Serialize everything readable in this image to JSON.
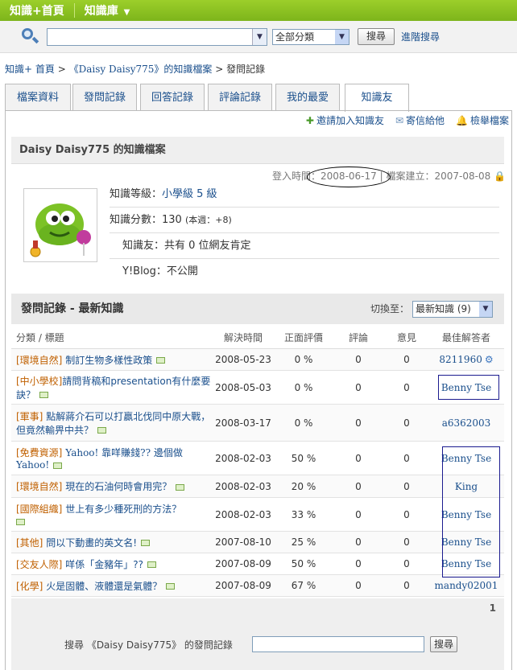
{
  "topbar": {
    "home": "知識+首頁",
    "library": "知識庫",
    "library_caret": "▼"
  },
  "search": {
    "placeholder": "",
    "dropdown": "▼",
    "category": "全部分類",
    "button": "搜尋",
    "advanced": "進階搜尋"
  },
  "breadcrumb": {
    "home": "知識+ 首頁",
    "sep1": ">",
    "profile": "《Daisy Daisy775》的知識檔案",
    "sep2": ">",
    "current": "發問記錄"
  },
  "tabs": [
    "檔案資料",
    "發問記錄",
    "回答記錄",
    "評論記錄",
    "我的最愛",
    "知識友"
  ],
  "actions": {
    "invite": "邀請加入知識友",
    "mail": "寄信給他",
    "report": "檢舉檔案"
  },
  "profile": {
    "heading": "Daisy Daisy775 的知識檔案",
    "login_label": "登入時間：",
    "login_date": "2008-06-17",
    "created_label": "| 檔案建立：",
    "created_date": "2007-08-08",
    "level_label": "知識等級：",
    "level_value": "小學級 5 級",
    "score_label": "知識分數：",
    "score_value": "130",
    "score_week": "(本週：+8)",
    "friends_label": "知識友：",
    "friends_value": "共有 0 位網友肯定",
    "blog_label": "Y!Blog：",
    "blog_value": "不公開"
  },
  "questions": {
    "title": "發問記錄 - 最新知識",
    "switch_label": "切換至：",
    "switch_value": "最新知識 (9)",
    "columns": [
      "分類 / 標題",
      "解決時間",
      "正面評價",
      "評論",
      "意見",
      "最佳解答者"
    ],
    "rows": [
      {
        "category": "[環境自然]",
        "title": "制訂生物多樣性政策",
        "date": "2008-05-23",
        "positive": "0 %",
        "comments": "0",
        "opinions": "0",
        "best": "8211960",
        "gear": "⚙"
      },
      {
        "category": "[中小學校]",
        "title": "請問背稿和presentation有什麼要訣？",
        "date": "2008-05-03",
        "positive": "0 %",
        "comments": "0",
        "opinions": "0",
        "best": "Benny Tse"
      },
      {
        "category": "[軍事]",
        "title": "點解蔣介石可以打贏北伐同中原大戰，但竟然輸畀中共？",
        "date": "2008-03-17",
        "positive": "0 %",
        "comments": "0",
        "opinions": "0",
        "best": "a6362003"
      },
      {
        "category": "[免費資源]",
        "title": "Yahoo! 靠咩賺錢?? 邊個做Yahoo!",
        "date": "2008-02-03",
        "positive": "50 %",
        "comments": "0",
        "opinions": "0",
        "best": "Benny Tse"
      },
      {
        "category": "[環境自然]",
        "title": "現在的石油何時會用完？",
        "date": "2008-02-03",
        "positive": "20 %",
        "comments": "0",
        "opinions": "0",
        "best": "King"
      },
      {
        "category": "[國際組織]",
        "title": "世上有多少種死刑的方法？",
        "date": "2008-02-03",
        "positive": "33 %",
        "comments": "0",
        "opinions": "0",
        "best": "Benny Tse"
      },
      {
        "category": "[其他]",
        "title": "問以下動畫的英文名!",
        "date": "2007-08-10",
        "positive": "25 %",
        "comments": "0",
        "opinions": "0",
        "best": "Benny Tse"
      },
      {
        "category": "[交友人際]",
        "title": "咩係「金豬年」??",
        "date": "2007-08-09",
        "positive": "50 %",
        "comments": "0",
        "opinions": "0",
        "best": "Benny Tse"
      },
      {
        "category": "[化學]",
        "title": "火是固體、液體還是氣體？",
        "date": "2007-08-09",
        "positive": "67 %",
        "comments": "0",
        "opinions": "0",
        "best": "mandy02001"
      }
    ],
    "page": "1"
  },
  "bottom_search": {
    "label": "搜尋 《Daisy Daisy775》 的發問記錄",
    "value": "",
    "button": "搜尋"
  }
}
